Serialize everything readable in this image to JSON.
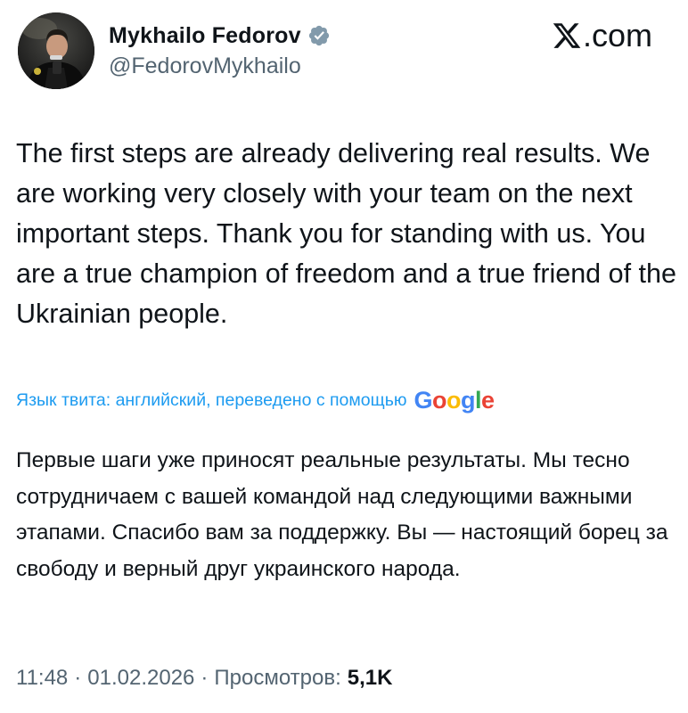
{
  "author": {
    "name": "Mykhailo Fedorov",
    "handle": "@FedorovMykhailo",
    "verified_icon": "verified-badge-icon"
  },
  "brand": {
    "logo_icon": "x-logo-icon",
    "suffix": ".com"
  },
  "tweet": {
    "text": "The first steps are already delivering real results. We are working very closely with your team on the next important steps. Thank you for standing with us. You are a true champion of freedom and a true friend of the Ukrainian people."
  },
  "translation": {
    "notice": "Язык твита: английский, переведено с помощью",
    "provider": "Google",
    "text": "Первые шаги уже приносят реальные результаты. Мы тесно сотрудничаем с вашей командой над следующими важными этапами. Спасибо вам за поддержку. Вы — настоящий борец за свободу и верный друг украинского народа."
  },
  "meta": {
    "time": "11:48",
    "date": "01.02.2026",
    "separator": "·",
    "views_label": "Просмотров:",
    "views_count": "5,1K"
  },
  "colors": {
    "text": "#0f1419",
    "secondary": "#536471",
    "link": "#1d9bf0",
    "verified": "#829aab"
  }
}
